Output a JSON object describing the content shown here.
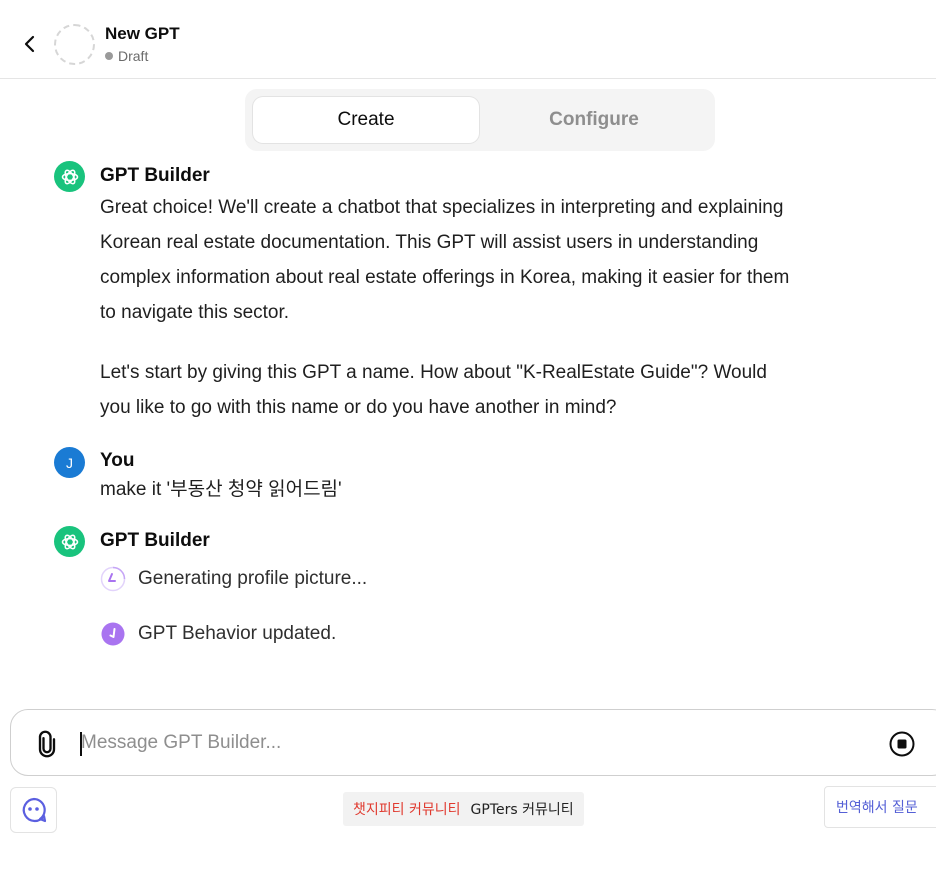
{
  "header": {
    "gpt_name": "New GPT",
    "status": "Draft"
  },
  "tabs": [
    {
      "label": "Create",
      "active": true
    },
    {
      "label": "Configure",
      "active": false
    }
  ],
  "conversation": [
    {
      "author": "GPT Builder",
      "paragraphs": [
        "Great choice! We'll create a chatbot that specializes in interpreting and explaining Korean real estate documentation. This GPT will assist users in understanding complex information about real estate offerings in Korea, making it easier for them to navigate this sector.",
        "Let's start by giving this GPT a name. How about \"K-RealEstate Guide\"? Would you like to go with this name or do you have another in mind?"
      ]
    },
    {
      "author": "You",
      "avatar_letter": "J",
      "text": "make it '부동산 청약 읽어드림'"
    },
    {
      "author": "GPT Builder",
      "statuses": [
        {
          "icon": "loading-spinner-icon",
          "text": "Generating profile picture..."
        },
        {
          "icon": "check-circle-icon",
          "text": "GPT Behavior updated."
        }
      ]
    }
  ],
  "composer": {
    "placeholder": "Message GPT Builder..."
  },
  "footer": {
    "community_red": "챗지피티 커뮤니티",
    "community_dark": "GPTers 커뮤니티",
    "translate_button": "번역해서 질문"
  },
  "colors": {
    "builder_avatar": "#19c37d",
    "user_avatar": "#1a7bd4",
    "status_purple": "#a974f0",
    "community_red": "#e03a2f",
    "translate_blue": "#5560d6"
  }
}
